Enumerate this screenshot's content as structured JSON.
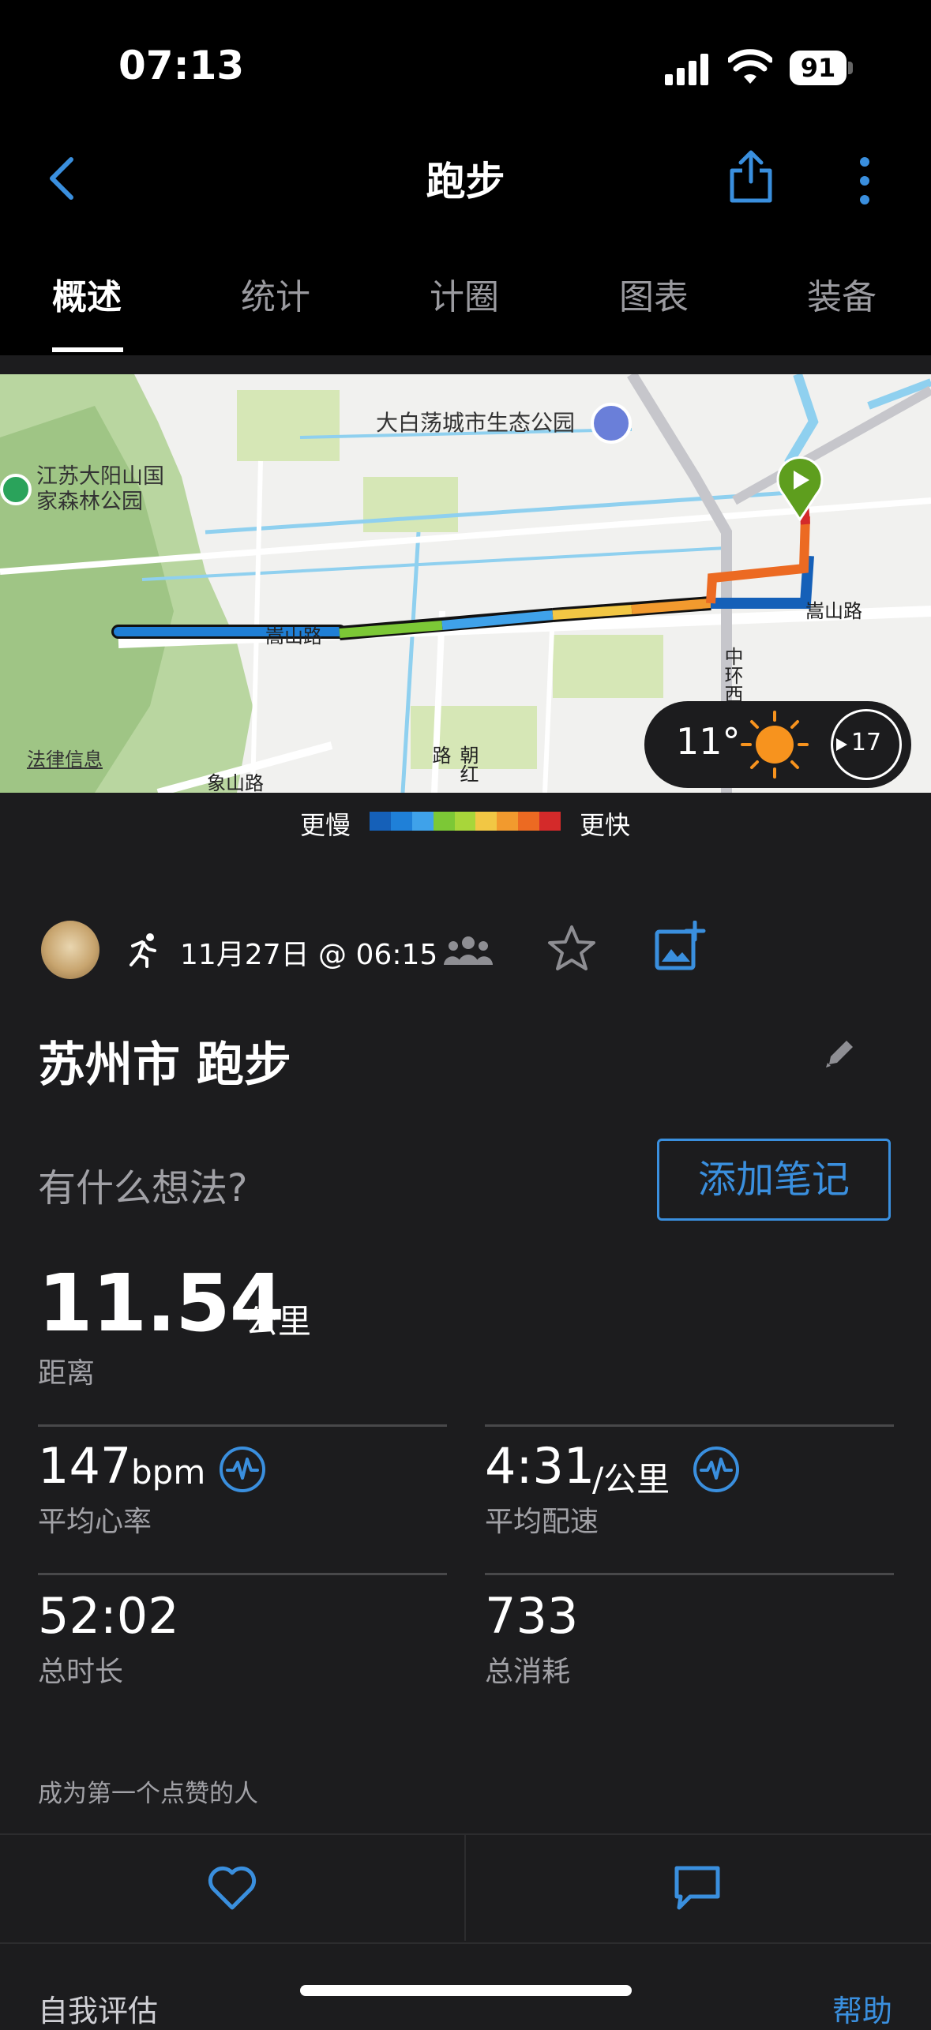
{
  "status_bar": {
    "time": "07:13",
    "battery": "91"
  },
  "header": {
    "title": "跑步"
  },
  "tabs": [
    {
      "label": "概述"
    },
    {
      "label": "统计"
    },
    {
      "label": "计圈"
    },
    {
      "label": "图表"
    },
    {
      "label": "装备"
    }
  ],
  "map": {
    "labels": {
      "park1": "大白荡城市生态公园",
      "park2_line1": "江苏大阳山国",
      "park2_line2": "家森林公园",
      "road1": "嵩山路",
      "road2": "嵩山路",
      "road3": "中环西",
      "road4": "朝红路",
      "road5": "象山路",
      "legal": "法律信息"
    },
    "weather": {
      "temp": "11°",
      "wind": "17"
    }
  },
  "legend": {
    "slower": "更慢",
    "faster": "更快",
    "colors": [
      "#1560b8",
      "#1f80d8",
      "#3fa2ea",
      "#7cc836",
      "#a8d63a",
      "#f2c744",
      "#f29a2e",
      "#ec6a22",
      "#d42a2a"
    ]
  },
  "activity": {
    "date": "11月27日 @ 06:15",
    "title": "苏州市 跑步",
    "prompt": "有什么想法?",
    "add_note": "添加笔记"
  },
  "stats": {
    "distance": {
      "value": "11.54",
      "unit": "公里",
      "label": "距离"
    },
    "heart_rate": {
      "value": "147",
      "unit": "bpm",
      "label": "平均心率"
    },
    "pace": {
      "value": "4:31",
      "unit": "/公里",
      "label": "平均配速"
    },
    "duration": {
      "value": "52:02",
      "label": "总时长"
    },
    "calories": {
      "value": "733",
      "label": "总消耗"
    }
  },
  "likes_text": "成为第一个点赞的人",
  "footer": {
    "self_eval": "自我评估",
    "help": "帮助"
  },
  "colors": {
    "accent": "#3a8fde",
    "background": "#1c1c1e"
  }
}
